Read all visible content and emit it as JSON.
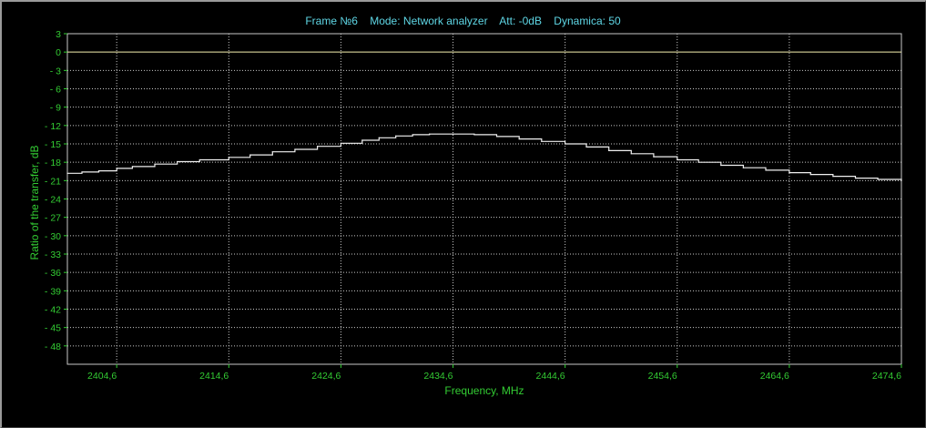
{
  "window": {
    "title": "Frame №6    Mode: Network analyzer    Att: -0dB    Dynamica: 50"
  },
  "chart_data": {
    "type": "line",
    "title": "Frame №6    Mode: Network analyzer    Att: -0dB    Dynamica: 50",
    "xlabel": "Frequency, MHz",
    "ylabel": "Ratio of the transfer, dB",
    "xlim": [
      2400.2,
      2474.6
    ],
    "ylim": [
      -51,
      3
    ],
    "x_ticks": [
      "2404,6",
      "2414,6",
      "2424,6",
      "2434,6",
      "2444,6",
      "2454,6",
      "2464,6",
      "2474,6"
    ],
    "y_ticks": [
      "3",
      "0",
      "- 3",
      "- 6",
      "- 9",
      "- 12",
      "- 15",
      "- 18",
      "- 21",
      "- 24",
      "- 27",
      "- 30",
      "- 33",
      "- 36",
      "- 39",
      "- 42",
      "- 45",
      "- 48"
    ],
    "grid": true,
    "colors": {
      "background": "#000000",
      "trace": "#f0f0f0",
      "reference_line": "#f5f0b0",
      "grid": "#c8c8c8",
      "axis_text": "#33cc33",
      "title_text": "#5fd7e6"
    },
    "series": [
      {
        "x": [
          2400.2,
          2401.5,
          2403.0,
          2404.6,
          2406.0,
          2408.0,
          2410.0,
          2412.0,
          2414.6,
          2416.5,
          2418.5,
          2420.5,
          2422.5,
          2424.6,
          2426.5,
          2428.0,
          2429.5,
          2431.0,
          2432.5,
          2434.6,
          2436.5,
          2438.5,
          2440.5,
          2442.5,
          2444.6,
          2446.5,
          2448.5,
          2450.5,
          2452.5,
          2454.6,
          2456.5,
          2458.5,
          2460.5,
          2462.5,
          2464.6,
          2466.5,
          2468.5,
          2470.5,
          2472.5,
          2474.6
        ],
        "y": [
          -19.8,
          -19.6,
          -19.4,
          -19.0,
          -18.7,
          -18.3,
          -17.9,
          -17.6,
          -17.2,
          -16.8,
          -16.3,
          -15.9,
          -15.4,
          -14.9,
          -14.4,
          -14.0,
          -13.7,
          -13.5,
          -13.4,
          -13.4,
          -13.5,
          -13.8,
          -14.2,
          -14.6,
          -15.0,
          -15.5,
          -16.1,
          -16.6,
          -17.1,
          -17.6,
          -18.0,
          -18.5,
          -18.9,
          -19.3,
          -19.7,
          -20.0,
          -20.3,
          -20.6,
          -20.8,
          -21.0
        ]
      }
    ],
    "reference_line_y": 0
  }
}
